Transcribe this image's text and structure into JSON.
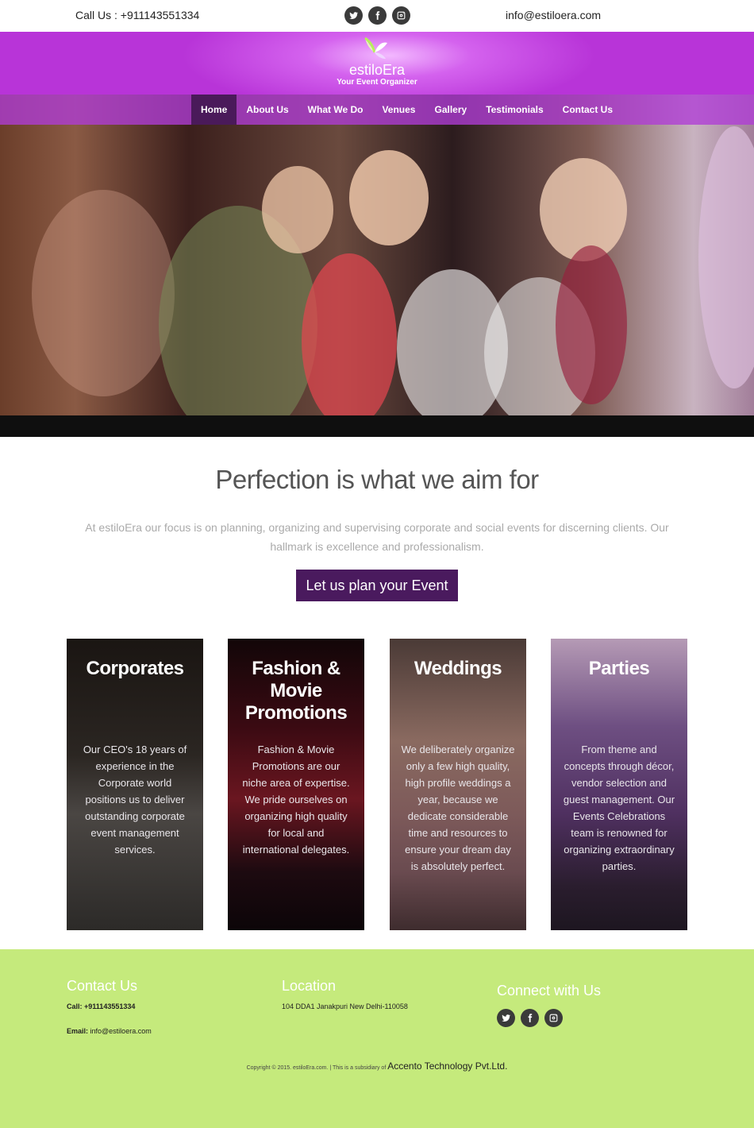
{
  "topbar": {
    "call": "Call Us : +911143551334",
    "email": "info@estiloera.com",
    "social": [
      "twitter-icon",
      "facebook-icon",
      "instagram-icon"
    ]
  },
  "brand": {
    "name": "estiloEra",
    "tagline": "Your Event Organizer",
    "colors": {
      "header": "#b834d8",
      "nav_active": "#4a1a5a",
      "cta": "#4a1a5e",
      "footer": "#c5ea7c"
    }
  },
  "nav": {
    "items": [
      {
        "label": "Home",
        "active": true
      },
      {
        "label": "About Us",
        "active": false
      },
      {
        "label": "What We Do",
        "active": false
      },
      {
        "label": "Venues",
        "active": false
      },
      {
        "label": "Gallery",
        "active": false
      },
      {
        "label": "Testimonials",
        "active": false
      },
      {
        "label": "Contact Us",
        "active": false
      }
    ]
  },
  "intro": {
    "title": "Perfection is what we aim for",
    "text": "At estiloEra our focus is on planning, organizing and supervising corporate and social events for discerning clients. Our hallmark is excellence and professionalism.",
    "cta": "Let us plan your Event"
  },
  "services": [
    {
      "title": "Corporates",
      "text": "Our CEO's 18 years of experience in the Corporate world positions us to deliver outstanding corporate event management services."
    },
    {
      "title": "Fashion & Movie Promotions",
      "text": "Fashion & Movie Promotions are our niche area of expertise. We pride ourselves on organizing high quality for local and international delegates."
    },
    {
      "title": "Weddings",
      "text": "We deliberately organize only a few high quality, high profile weddings a year, because we dedicate considerable time and resources to ensure your dream day is absolutely perfect."
    },
    {
      "title": "Parties",
      "text": "From theme and concepts through décor, vendor selection and guest management. Our Events Celebrations team is renowned for organizing extraordinary parties."
    }
  ],
  "footer": {
    "contact": {
      "heading": "Contact Us",
      "call_label": "Call:",
      "call_value": "+911143551334",
      "email_label": "Email:",
      "email_value": "info@estiloera.com"
    },
    "location": {
      "heading": "Location",
      "address": "104 DDA1 Janakpuri New Delhi-110058"
    },
    "connect": {
      "heading": "Connect with Us",
      "social": [
        "twitter-icon",
        "facebook-icon",
        "instagram-icon"
      ]
    },
    "copyright": "Copyright © 2015. estiloEra.com. | This is a subsidiary of",
    "company": "Accento Technology Pvt.Ltd."
  }
}
